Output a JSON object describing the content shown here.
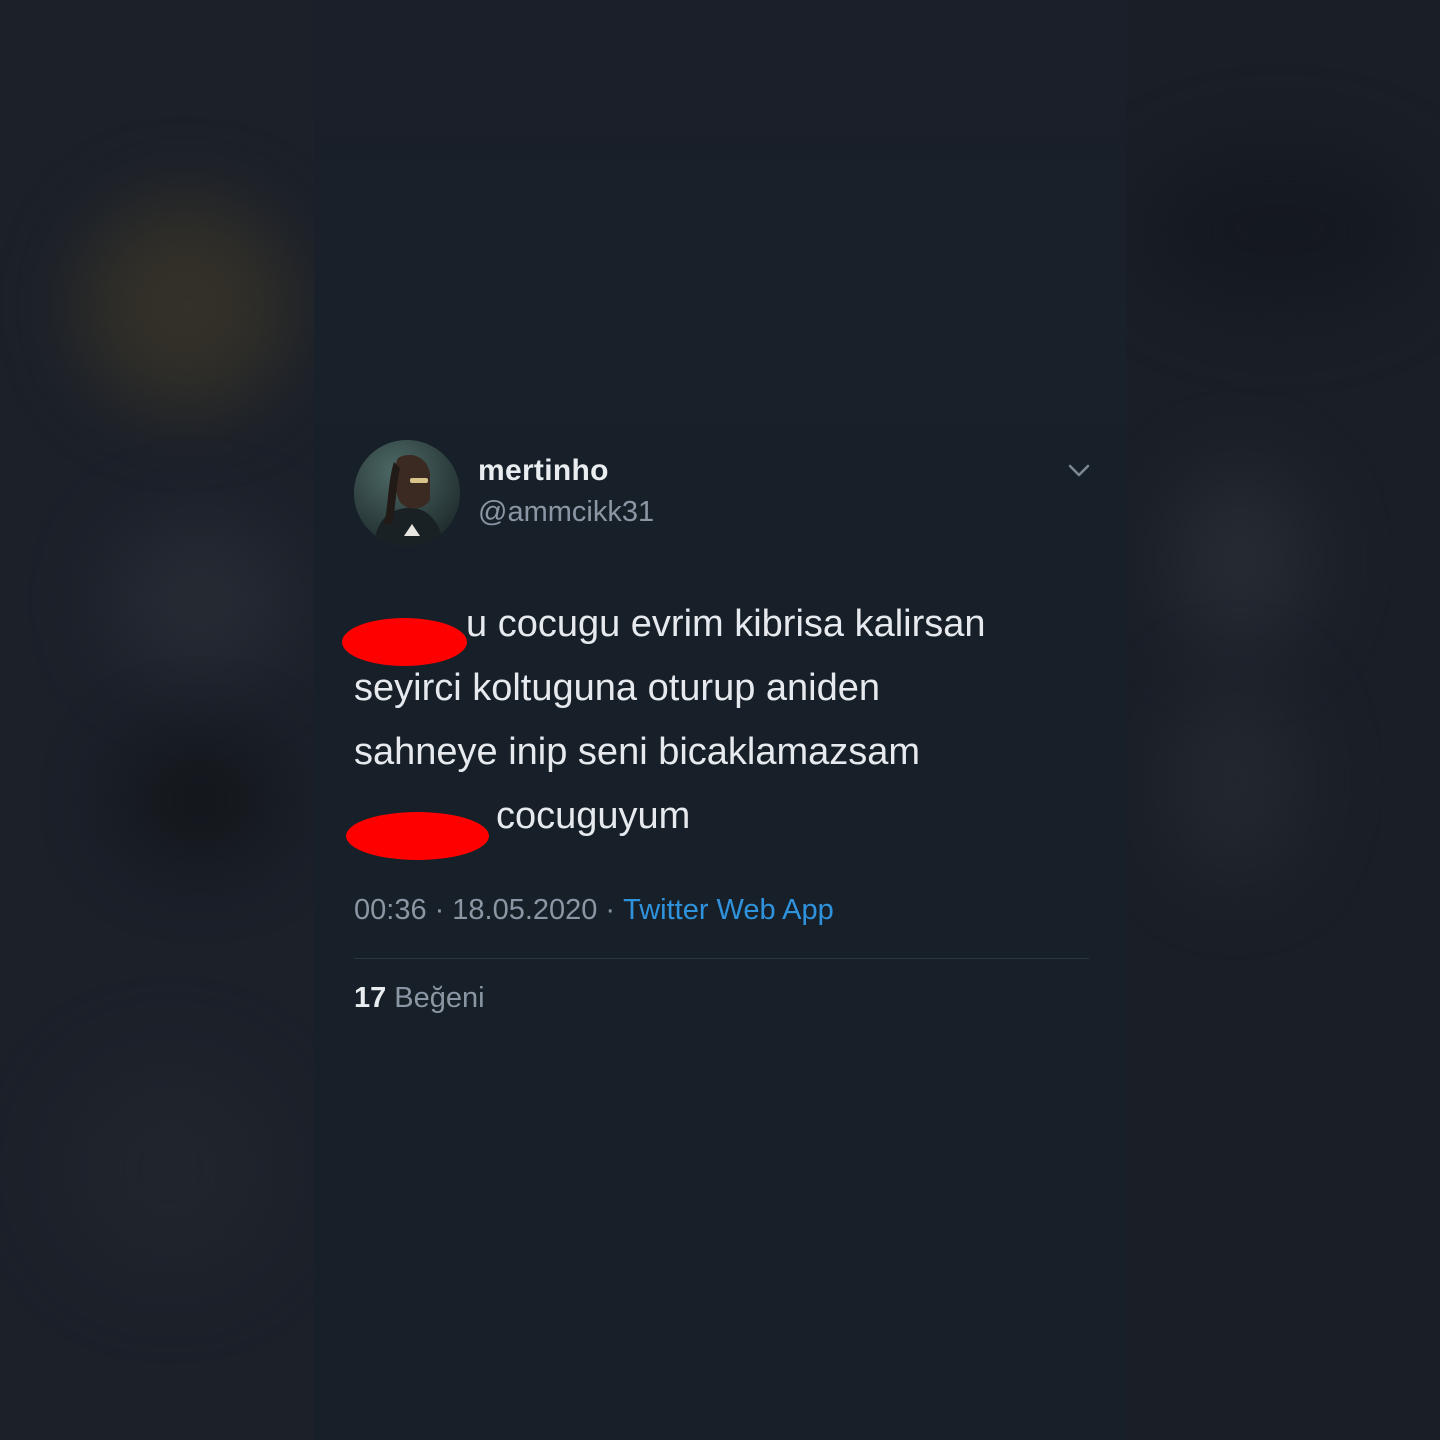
{
  "tweet": {
    "display_name": "mertinho",
    "handle": "@ammcikk31",
    "text_lines": [
      "u cocugu evrim kibrisa kalirsan",
      "seyirci koltuguna oturup aniden",
      "sahneye inip seni bicaklamazsam",
      "cocuguyum"
    ],
    "time": "00:36",
    "date": "18.05.2020",
    "separator": "·",
    "source": "Twitter Web App",
    "likes_count": "17",
    "likes_label": "Beğeni"
  },
  "colors": {
    "background": "#171c25",
    "card": "#172029",
    "text": "#e6eaee",
    "muted": "#8a96a3",
    "link": "#2f92dd",
    "censor": "#ff0000"
  },
  "icons": {
    "menu": "chevron-down-icon",
    "avatar": "profile-avatar"
  }
}
